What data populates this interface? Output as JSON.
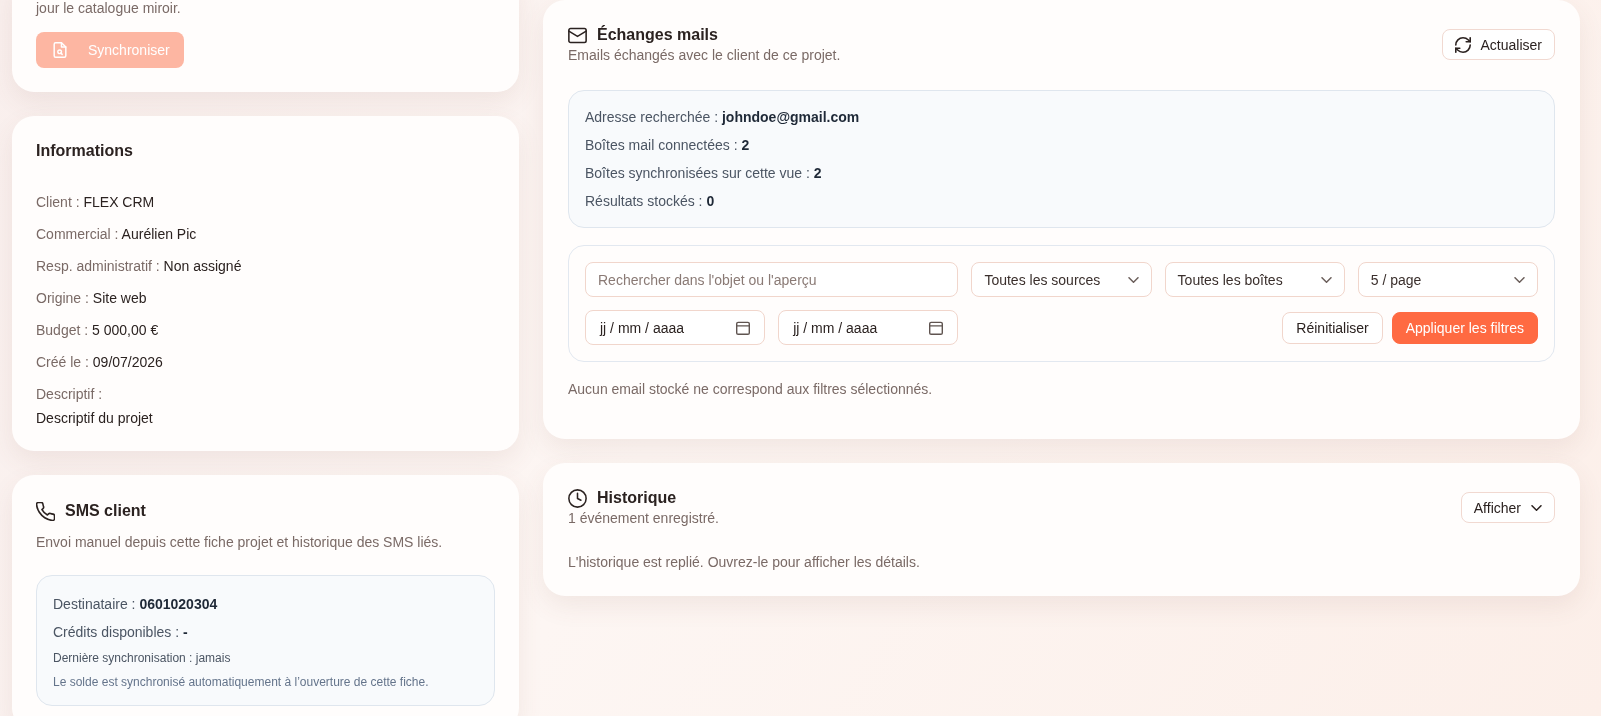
{
  "sync_card": {
    "text": "jour le catalogue miroir.",
    "button": {
      "label": "Synchroniser",
      "disabled": true
    }
  },
  "informations": {
    "title": "Informations",
    "fields": [
      {
        "label": "Client :",
        "value": "FLEX CRM"
      },
      {
        "label": "Commercial :",
        "value": "Aurélien Pic"
      },
      {
        "label": "Resp. administratif :",
        "value": "Non assigné"
      },
      {
        "label": "Origine :",
        "value": "Site web"
      },
      {
        "label": "Budget :",
        "value": "5 000,00 €"
      },
      {
        "label": "Créé le :",
        "value": "09/07/2026"
      }
    ],
    "description": {
      "label": "Descriptif :",
      "value": "Descriptif du projet"
    }
  },
  "sms": {
    "title": "SMS client",
    "subtitle": "Envoi manuel depuis cette fiche projet et historique des SMS liés.",
    "details": [
      {
        "kind": "field",
        "label": "Destinataire :",
        "value": "0601020304"
      },
      {
        "kind": "field",
        "label": "Crédits disponibles :",
        "value": "-"
      },
      {
        "kind": "meta",
        "text": "Dernière synchronisation : jamais"
      },
      {
        "kind": "hint",
        "text": "Le solde est synchronisé automatiquement à l’ouverture de cette fiche."
      }
    ]
  },
  "emails": {
    "title": "Échanges mails",
    "subtitle": "Emails échangés avec le client de ce projet.",
    "refresh_button": "Actualiser",
    "stats": [
      {
        "label": "Adresse recherchée :",
        "value": "johndoe@gmail.com"
      },
      {
        "label": "Boîtes mail connectées :",
        "value": "2"
      },
      {
        "label": "Boîtes synchronisées sur cette vue :",
        "value": "2"
      },
      {
        "label": "Résultats stockés :",
        "value": "0"
      }
    ],
    "filters": {
      "search": {
        "placeholder": "Rechercher dans l'objet ou l'aperçu"
      },
      "dropdowns": [
        "Toutes les sources",
        "Toutes les boîtes",
        "5 / page"
      ],
      "date_fields": [
        {
          "placeholder": "jj / mm / aaaa"
        },
        {
          "placeholder": "jj / mm / aaaa"
        }
      ],
      "buttons": [
        {
          "label": "Réinitialiser",
          "kind": "secondary"
        },
        {
          "label": "Appliquer les filtres",
          "kind": "primary"
        }
      ]
    },
    "empty_message": "Aucun email stocké ne correspond aux filtres sélectionnés."
  },
  "history": {
    "title": "Historique",
    "subtitle": "1 événement enregistré.",
    "toggle": {
      "label": "Afficher",
      "expanded": false
    },
    "message": "L'historique est replié. Ouvrez-le pour afficher les détails."
  }
}
